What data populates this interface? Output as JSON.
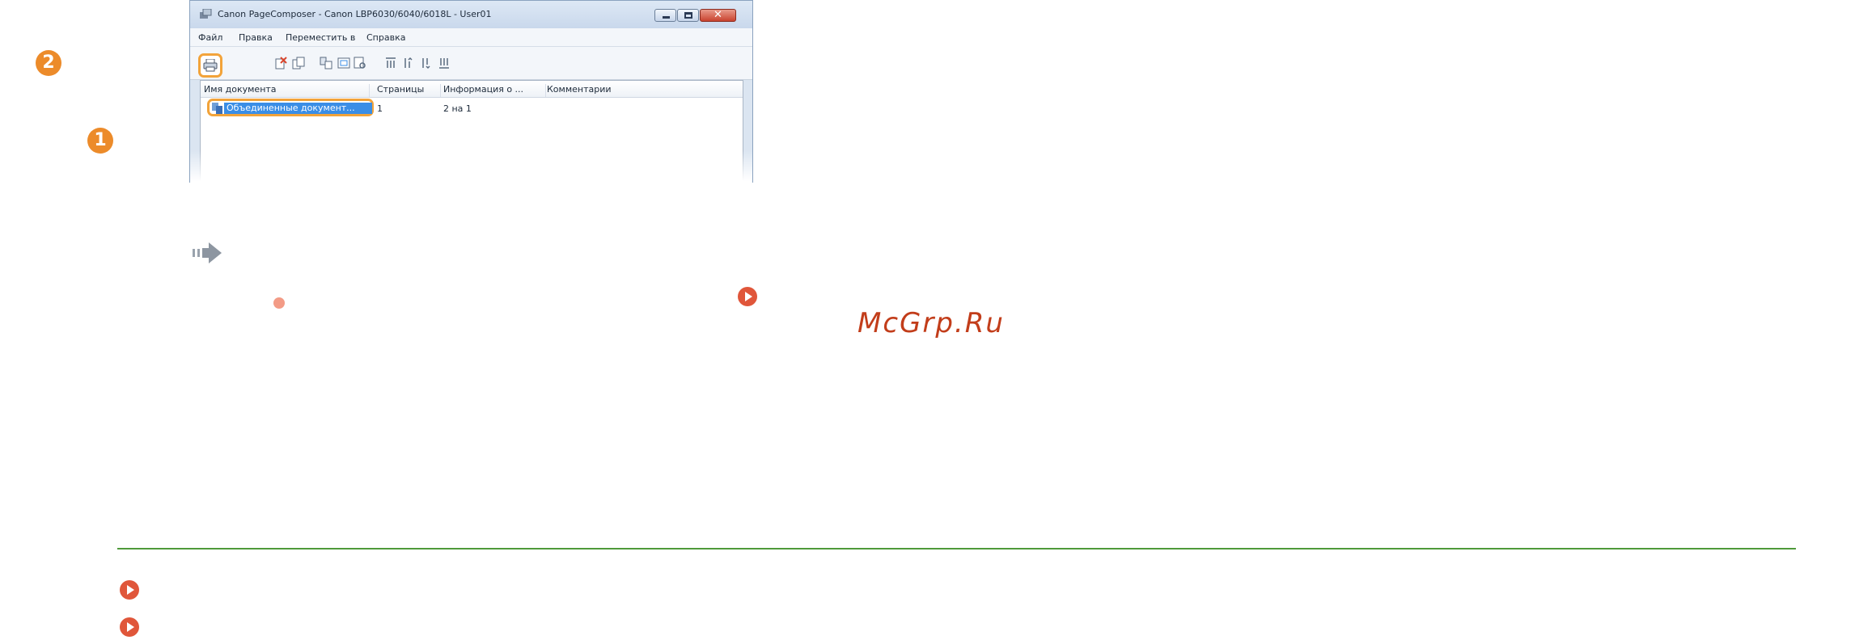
{
  "window": {
    "title": "Canon PageComposer - Canon LBP6030/6040/6018L - User01",
    "menu": [
      "Файл",
      "Правка",
      "Переместить в",
      "Справка"
    ],
    "toolbar_icons": [
      "print-icon",
      "delete-icon",
      "copy-icon",
      "combine-icon",
      "edit-icon",
      "preview-icon",
      "move-top-icon",
      "move-up-icon",
      "move-down-icon",
      "move-bottom-icon"
    ],
    "columns": [
      "Имя документа",
      "Страницы",
      "Информация о ...",
      "Комментарии"
    ],
    "rows": [
      {
        "name": "Объединенные документ...",
        "pages": "1",
        "info": "2 на 1",
        "comments": ""
      }
    ],
    "callouts": {
      "print": "2",
      "document": "1"
    }
  },
  "watermark": "McGrp.Ru",
  "colors": {
    "accent": "#ec8b2a",
    "link_icon": "#e0563a",
    "divider": "#4f9a3a",
    "selection": "#3a8ee6"
  }
}
